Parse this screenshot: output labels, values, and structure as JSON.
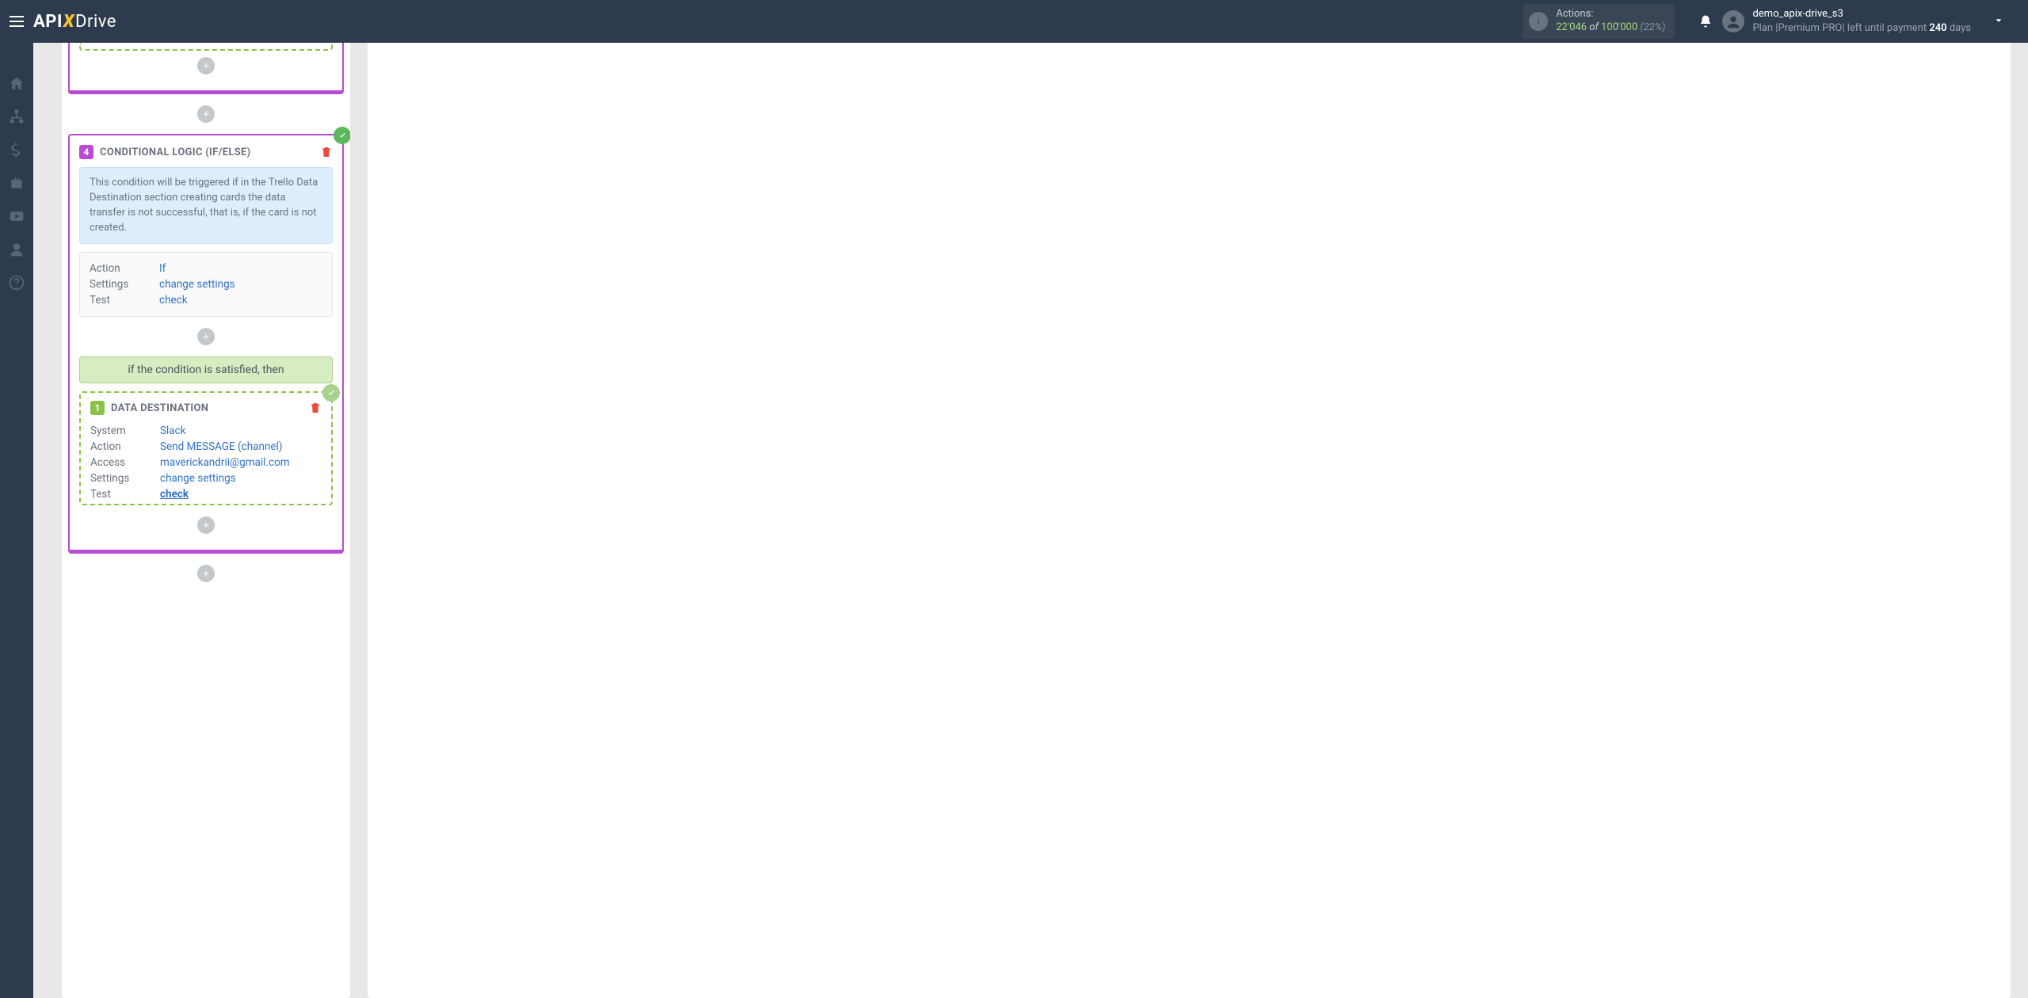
{
  "header": {
    "actions_label": "Actions:",
    "actions_used": "22'046",
    "actions_of": " of ",
    "actions_total": "100'000",
    "actions_pct": " (22%)",
    "user_name": "demo_apix-drive_s3",
    "plan_prefix": "Plan |Premium PRO| left until payment ",
    "plan_days": "240",
    "plan_suffix": " days"
  },
  "block4": {
    "num": "4",
    "title": "CONDITIONAL LOGIC (IF/ELSE)",
    "info": "This condition will be triggered if in the Trello Data Destination section creating cards the data transfer is not successful, that is, if the card is not created.",
    "rows": {
      "action_label": "Action",
      "action_value": "If",
      "settings_label": "Settings",
      "settings_value": "change settings",
      "test_label": "Test",
      "test_value": "check"
    },
    "banner": "if the condition is satisfied, then"
  },
  "dest": {
    "num": "1",
    "title": "DATA DESTINATION",
    "rows": {
      "system_label": "System",
      "system_value": "Slack",
      "action_label": "Action",
      "action_value": "Send MESSAGE (channel)",
      "access_label": "Access",
      "access_value": "maverickandrii@gmail.com",
      "settings_label": "Settings",
      "settings_value": "change settings",
      "test_label": "Test",
      "test_value": "check"
    }
  }
}
